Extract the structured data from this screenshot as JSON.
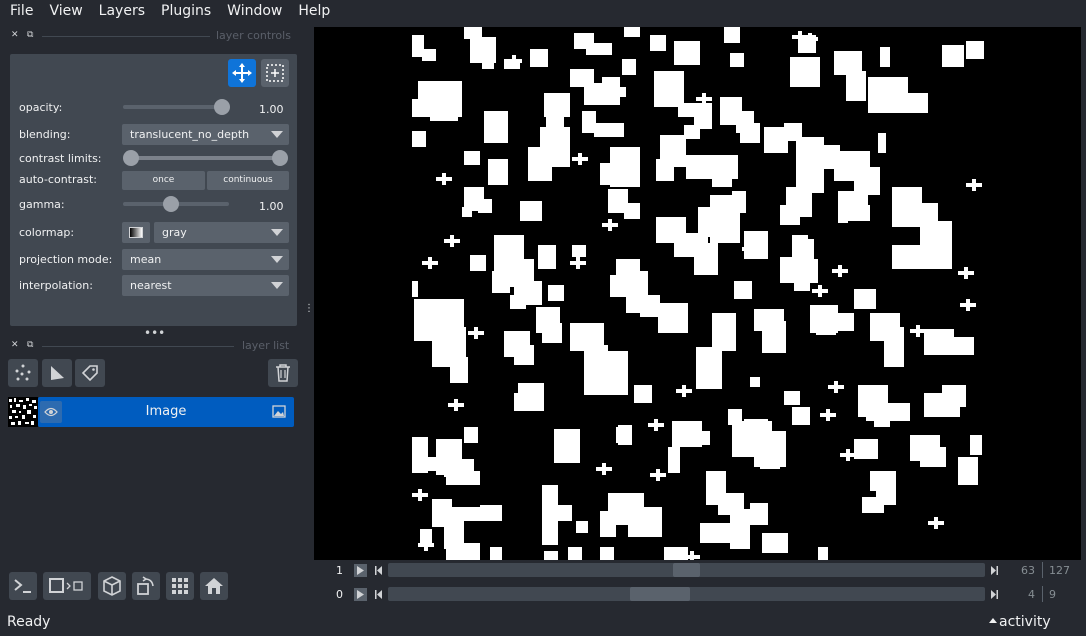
{
  "menu": [
    "File",
    "View",
    "Layers",
    "Plugins",
    "Window",
    "Help"
  ],
  "layer_controls": {
    "title": "layer controls",
    "opacity_label": "opacity:",
    "opacity_value": "1.00",
    "blending_label": "blending:",
    "blending_value": "translucent_no_depth",
    "contrast_label": "contrast limits:",
    "autocontrast_label": "auto-contrast:",
    "once_label": "once",
    "continuous_label": "continuous",
    "gamma_label": "gamma:",
    "gamma_value": "1.00",
    "colormap_label": "colormap:",
    "colormap_value": "gray",
    "projection_label": "projection mode:",
    "projection_value": "mean",
    "interpolation_label": "interpolation:",
    "interpolation_value": "nearest",
    "opacity_fraction": 1.0,
    "gamma_fraction": 0.47
  },
  "layer_list": {
    "title": "layer list",
    "layers": [
      {
        "name": "Image",
        "visible": true
      }
    ]
  },
  "dims": [
    {
      "label": "1",
      "current": "63",
      "total": "127",
      "fraction": 0.5
    },
    {
      "label": "0",
      "current": "4",
      "total": "9",
      "fraction": 0.45
    }
  ],
  "status": {
    "text": "Ready",
    "activity": "activity"
  },
  "colors": {
    "accent": "#0f74d9",
    "layer_selected": "#005cbf",
    "background": "#262930",
    "panel": "#414851"
  }
}
